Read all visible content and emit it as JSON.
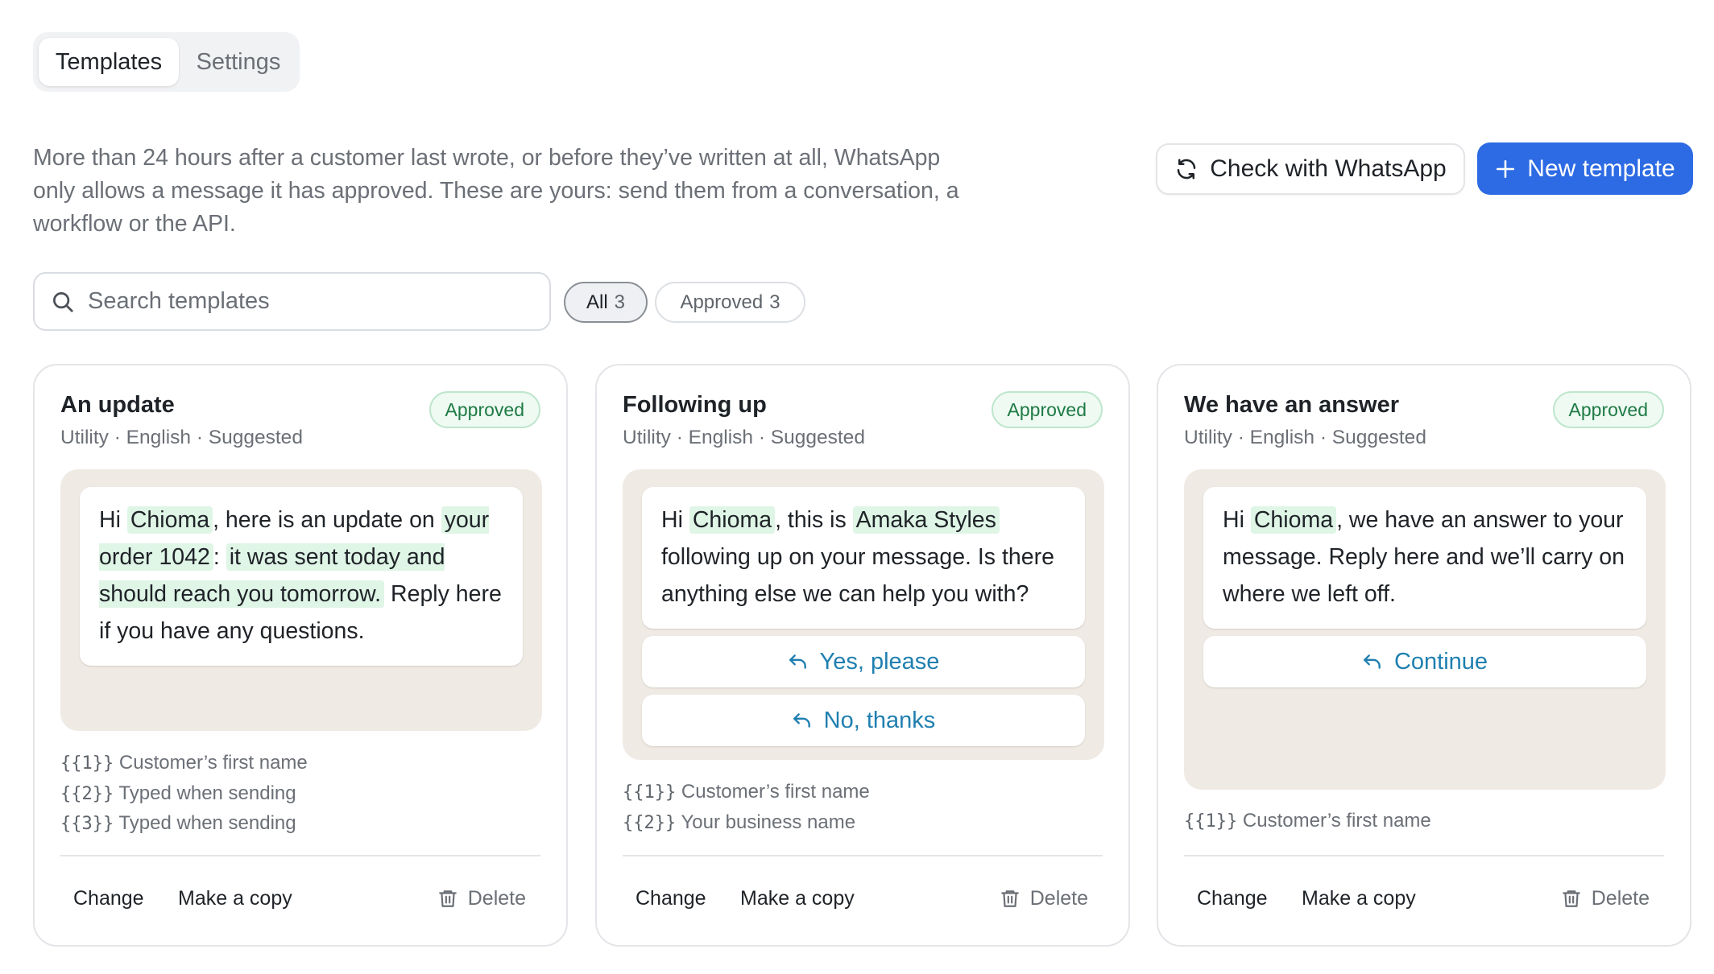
{
  "tabs": [
    {
      "label": "Templates",
      "active": true
    },
    {
      "label": "Settings",
      "active": false
    }
  ],
  "intro": "More than 24 hours after a customer last wrote, or before they’ve written at all, WhatsApp only allows a message it has approved. These are yours: send them from a conversation, a workflow or the API.",
  "header_buttons": {
    "check_label": "Check with WhatsApp",
    "check_icon": "refresh-icon",
    "new_label": "New template",
    "new_icon": "plus-icon"
  },
  "search": {
    "placeholder": "Search templates",
    "value": ""
  },
  "filters": [
    {
      "label": "All",
      "count": "3",
      "selected": true
    },
    {
      "label": "Approved",
      "count": "3",
      "selected": false
    }
  ],
  "colors": {
    "accent": "#2d6be4",
    "approved_bg": "#eefaf2",
    "approved_text": "#1f7a45",
    "variable_highlight": "#dff5e6",
    "preview_bg": "#efeae3",
    "reply_button_text": "#1f7fb0"
  },
  "cards": [
    {
      "title": "An update",
      "meta": "Utility · English · Suggested",
      "status": "Approved",
      "message": {
        "t0": "Hi ",
        "v1": "Chioma",
        "t1": ", here is an update on ",
        "v2": "your order 1042",
        "t2": ": ",
        "v3": "it was sent today and should reach you tomorrow.",
        "t3": " Reply here if you have any questions."
      },
      "variables": [
        {
          "code": "{{1}}",
          "desc": "Customer’s first name"
        },
        {
          "code": "{{2}}",
          "desc": "Typed when sending"
        },
        {
          "code": "{{3}}",
          "desc": "Typed when sending"
        }
      ],
      "actions": {
        "change": "Change",
        "copy": "Make a copy",
        "delete": "Delete"
      }
    },
    {
      "title": "Following up",
      "meta": "Utility · English · Suggested",
      "status": "Approved",
      "message": {
        "t0": "Hi ",
        "v1": "Chioma",
        "t1": ", this is ",
        "v2": "Amaka Styles",
        "t2": " following up on your message. Is there anything else we can help you with?"
      },
      "quick_replies": [
        "Yes, please",
        "No, thanks"
      ],
      "variables": [
        {
          "code": "{{1}}",
          "desc": "Customer’s first name"
        },
        {
          "code": "{{2}}",
          "desc": "Your business name"
        }
      ],
      "actions": {
        "change": "Change",
        "copy": "Make a copy",
        "delete": "Delete"
      }
    },
    {
      "title": "We have an answer",
      "meta": "Utility · English · Suggested",
      "status": "Approved",
      "message": {
        "t0": "Hi ",
        "v1": "Chioma",
        "t1": ", we have an answer to your message. Reply here and we’ll carry on where we left off."
      },
      "quick_replies": [
        "Continue"
      ],
      "variables": [
        {
          "code": "{{1}}",
          "desc": "Customer’s first name"
        }
      ],
      "actions": {
        "change": "Change",
        "copy": "Make a copy",
        "delete": "Delete"
      }
    }
  ]
}
